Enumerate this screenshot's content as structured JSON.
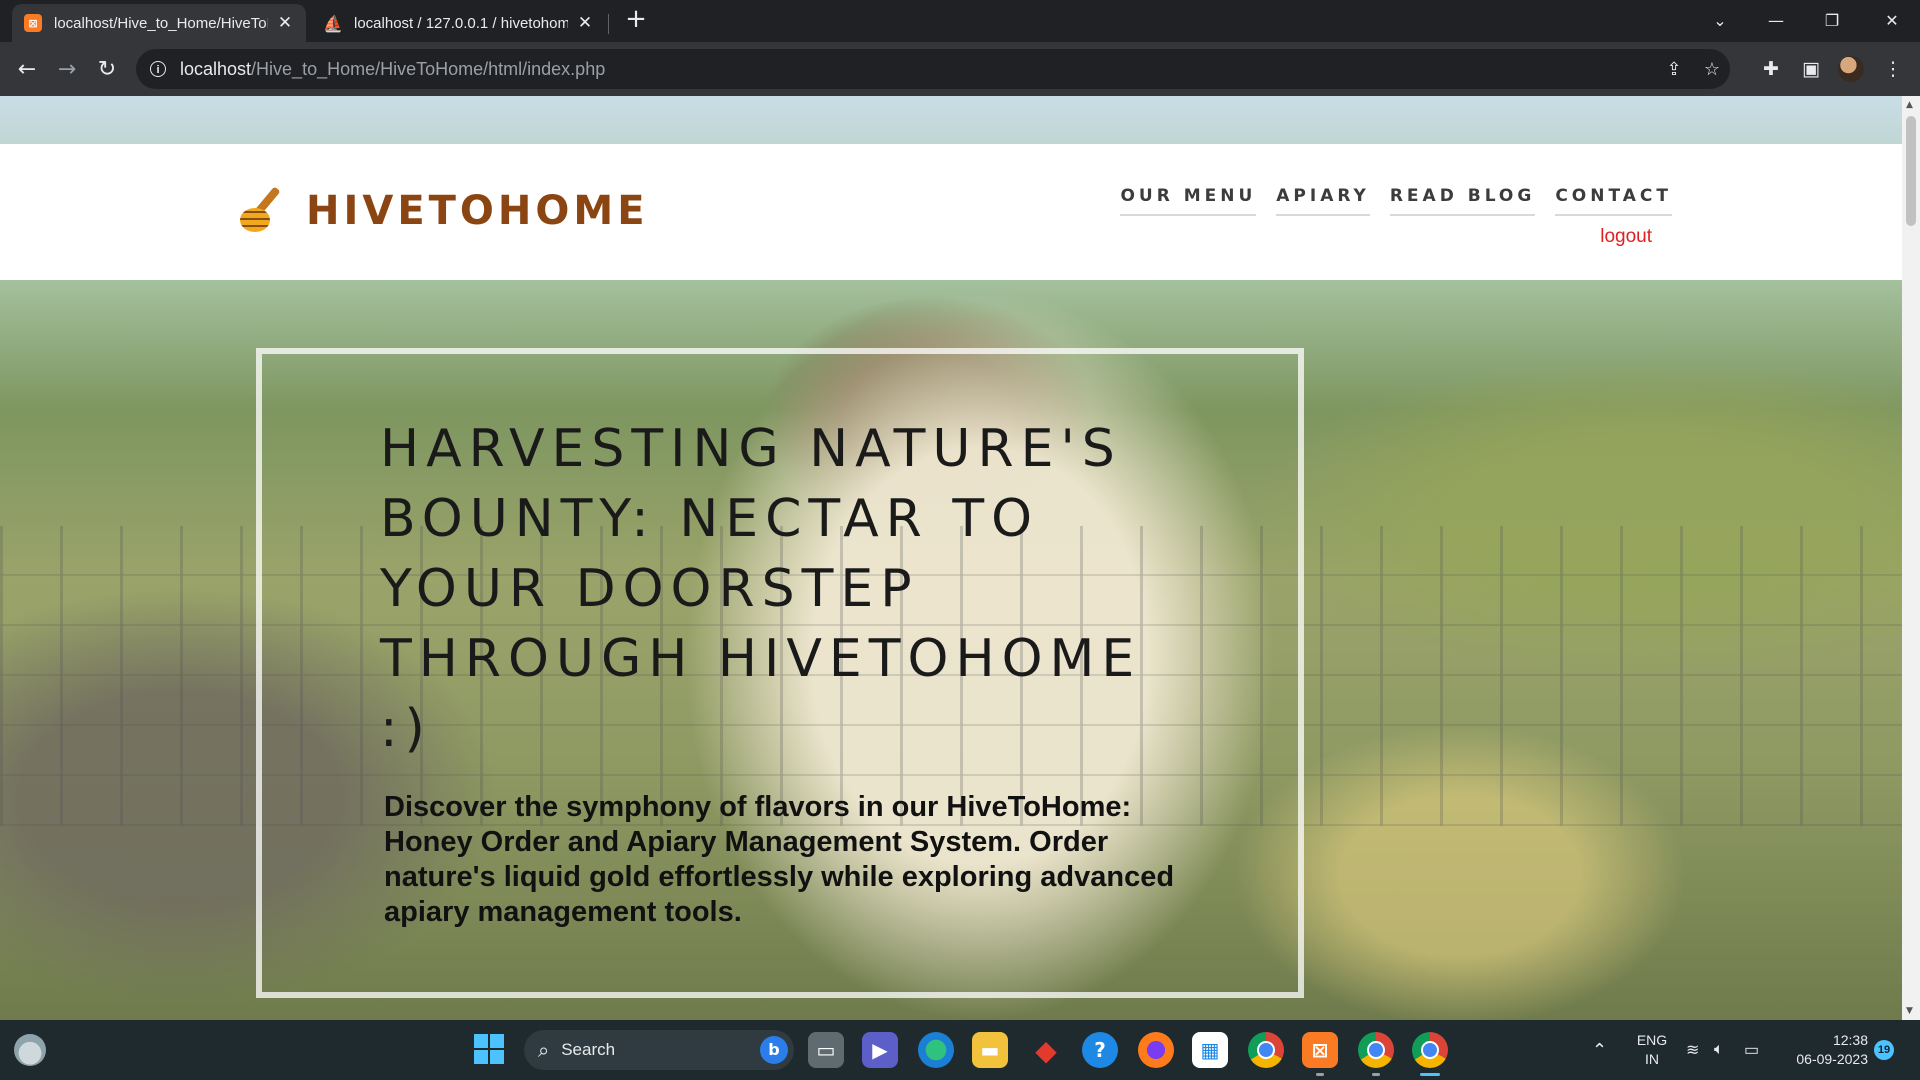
{
  "browser": {
    "tabs": [
      {
        "title": "localhost/Hive_to_Home/HiveToH",
        "favicon": "xampp-icon",
        "active": true
      },
      {
        "title": "localhost / 127.0.0.1 / hivetohom",
        "favicon": "phpmyadmin-icon",
        "active": false
      }
    ],
    "new_tab_label": "+",
    "window_controls": [
      "minimize-icon",
      "restore-icon",
      "close-icon"
    ],
    "address": {
      "host": "localhost",
      "path": "/Hive_to_Home/HiveToHome/html/index.php"
    }
  },
  "site": {
    "brand": "HIVETOHOME",
    "nav": [
      {
        "label": "OUR MENU"
      },
      {
        "label": "APIARY"
      },
      {
        "label": "READ BLOG"
      },
      {
        "label": "CONTACT"
      }
    ],
    "logout_label": "logout",
    "hero": {
      "title": "HARVESTING NATURE'S BOUNTY: NECTAR TO YOUR DOORSTEP THROUGH HIVETOHOME :)",
      "text": "Discover the symphony of flavors in our HiveToHome: Honey Order and Apiary Management System. Order nature's liquid gold effortlessly while exploring advanced apiary management tools."
    },
    "colors": {
      "brand": "#8b4513",
      "logout": "#e02020",
      "nav_text": "#3c3c3c"
    }
  },
  "taskbar": {
    "search_label": "Search",
    "apps": [
      "task-view-icon",
      "teams-meet-icon",
      "edge-icon",
      "file-explorer-icon",
      "app-red-diamond-icon",
      "help-icon",
      "firefox-icon",
      "microsoft-store-icon",
      "chrome-icon",
      "xampp-icon",
      "chrome-profile-icon",
      "chrome-active-icon"
    ],
    "lang_top": "ENG",
    "lang_bottom": "IN",
    "time": "12:38",
    "date": "06-09-2023",
    "notification_count": "19"
  }
}
